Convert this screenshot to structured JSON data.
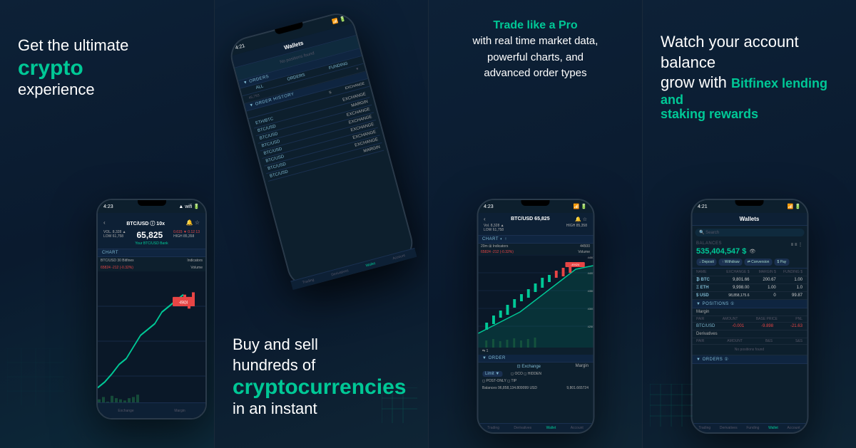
{
  "panel1": {
    "line1": "Get the ultimate",
    "line2": "crypto",
    "line3": "experience",
    "phone": {
      "statusTime": "4:23",
      "ticker": "BTC/USD",
      "price": "65,825",
      "vol": "Vol. 8,328",
      "low": "61,758",
      "high": "85,358",
      "chartLabel": "BTC/USD 30 Bitfinex",
      "chartValue": "65824",
      "chartChange": "-212 (-0.32%)",
      "indicator": "Indicators"
    }
  },
  "panel2": {
    "line1": "Buy and sell",
    "line2": "hundreds of",
    "line3": "cryptocurrencies",
    "line4": "in an instant",
    "phone": {
      "statusTime": "4:21",
      "title": "Wallets",
      "ordersHeader": "ORDERS",
      "orderHistoryHeader": "ORDER HISTORY",
      "orders": [
        {
          "pair": "ETH/BTC",
          "type": "EXCHANGE"
        },
        {
          "pair": "BTC/USD",
          "type": "EXCHANGE"
        },
        {
          "pair": "BTC/USD",
          "type": "MARGIN"
        },
        {
          "pair": "BTC/USD",
          "type": "EXCHANGE"
        },
        {
          "pair": "BTC/USD",
          "type": "EXCHANGE"
        },
        {
          "pair": "BTC/USD",
          "type": "EXCHANGE"
        },
        {
          "pair": "BTC/USD",
          "type": "EXCHANGE"
        },
        {
          "pair": "BTC/USD",
          "type": "EXCHANGE"
        },
        {
          "pair": "BTC/USD",
          "type": "MARGIN"
        }
      ]
    }
  },
  "panel3": {
    "line1": "Trade like a Pro",
    "line2": "with real time market data,",
    "line3": "powerful charts, and",
    "line4": "advanced order types",
    "phone": {
      "statusTime": "4:23",
      "ticker": "BTC/USD 65,825",
      "vol": "8,328",
      "low": "61,758",
      "high": "85,358",
      "chartLabel": "BTC/USD 30 Bitfinex",
      "chartValue": "65824",
      "chartChange": "-212 (-0.32%)",
      "orderType": "Limit",
      "exchange": "Exchange",
      "margin": "Margin"
    }
  },
  "panel4": {
    "line1": "Watch your account balance",
    "line2a": "grow with ",
    "line2b": "Bitfinex lending and",
    "line3": "staking rewards",
    "phone": {
      "statusTime": "4:21",
      "title": "Wallets",
      "balanceLabel": "BALANCES",
      "balanceAmount": "535,404,547 $",
      "actions": [
        "Deposit",
        "Withdraw",
        "Conversion",
        "Pay"
      ],
      "assets": [
        {
          "symbol": "BTC",
          "amount": "9,801.66",
          "margin": "200.67",
          "funding": "1.0"
        },
        {
          "symbol": "ETH",
          "amount": "9,998.00",
          "margin": "1.00",
          "funding": "1.0"
        },
        {
          "symbol": "USD",
          "amount": "98,858,175.6",
          "margin": "0",
          "funding": "99.87"
        }
      ],
      "positionsLabel": "POSITIONS",
      "positionsType": "Margin",
      "btcusdPos": "BTC/USD",
      "posAmount": "-0.001",
      "posValue": "-9.898",
      "posPnl": "-21.63",
      "ordersLabel": "ORDERS",
      "tabs": [
        "Trading",
        "Derivatives",
        "Funding",
        "Wallet",
        "Account"
      ]
    }
  }
}
